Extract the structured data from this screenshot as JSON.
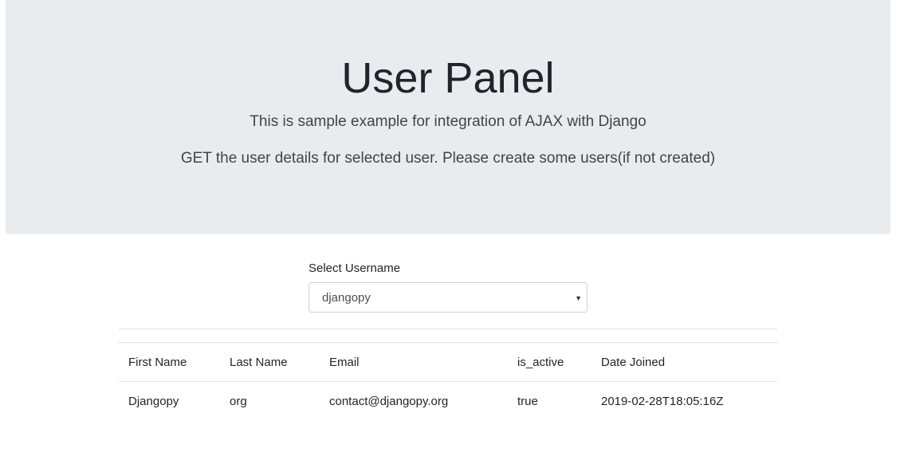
{
  "header": {
    "title": "User Panel",
    "lead_1": "This is sample example for integration of AJAX with Django",
    "lead_2": "GET the user details for selected user. Please create some users(if not created)"
  },
  "form": {
    "label": "Select Username",
    "selected_value": "djangopy",
    "arrow_icon": "caret-down-icon"
  },
  "table": {
    "headers": [
      "First Name",
      "Last Name",
      "Email",
      "is_active",
      "Date Joined"
    ],
    "rows": [
      [
        "Djangopy",
        "org",
        "contact@djangopy.org",
        "true",
        "2019-02-28T18:05:16Z"
      ]
    ]
  }
}
